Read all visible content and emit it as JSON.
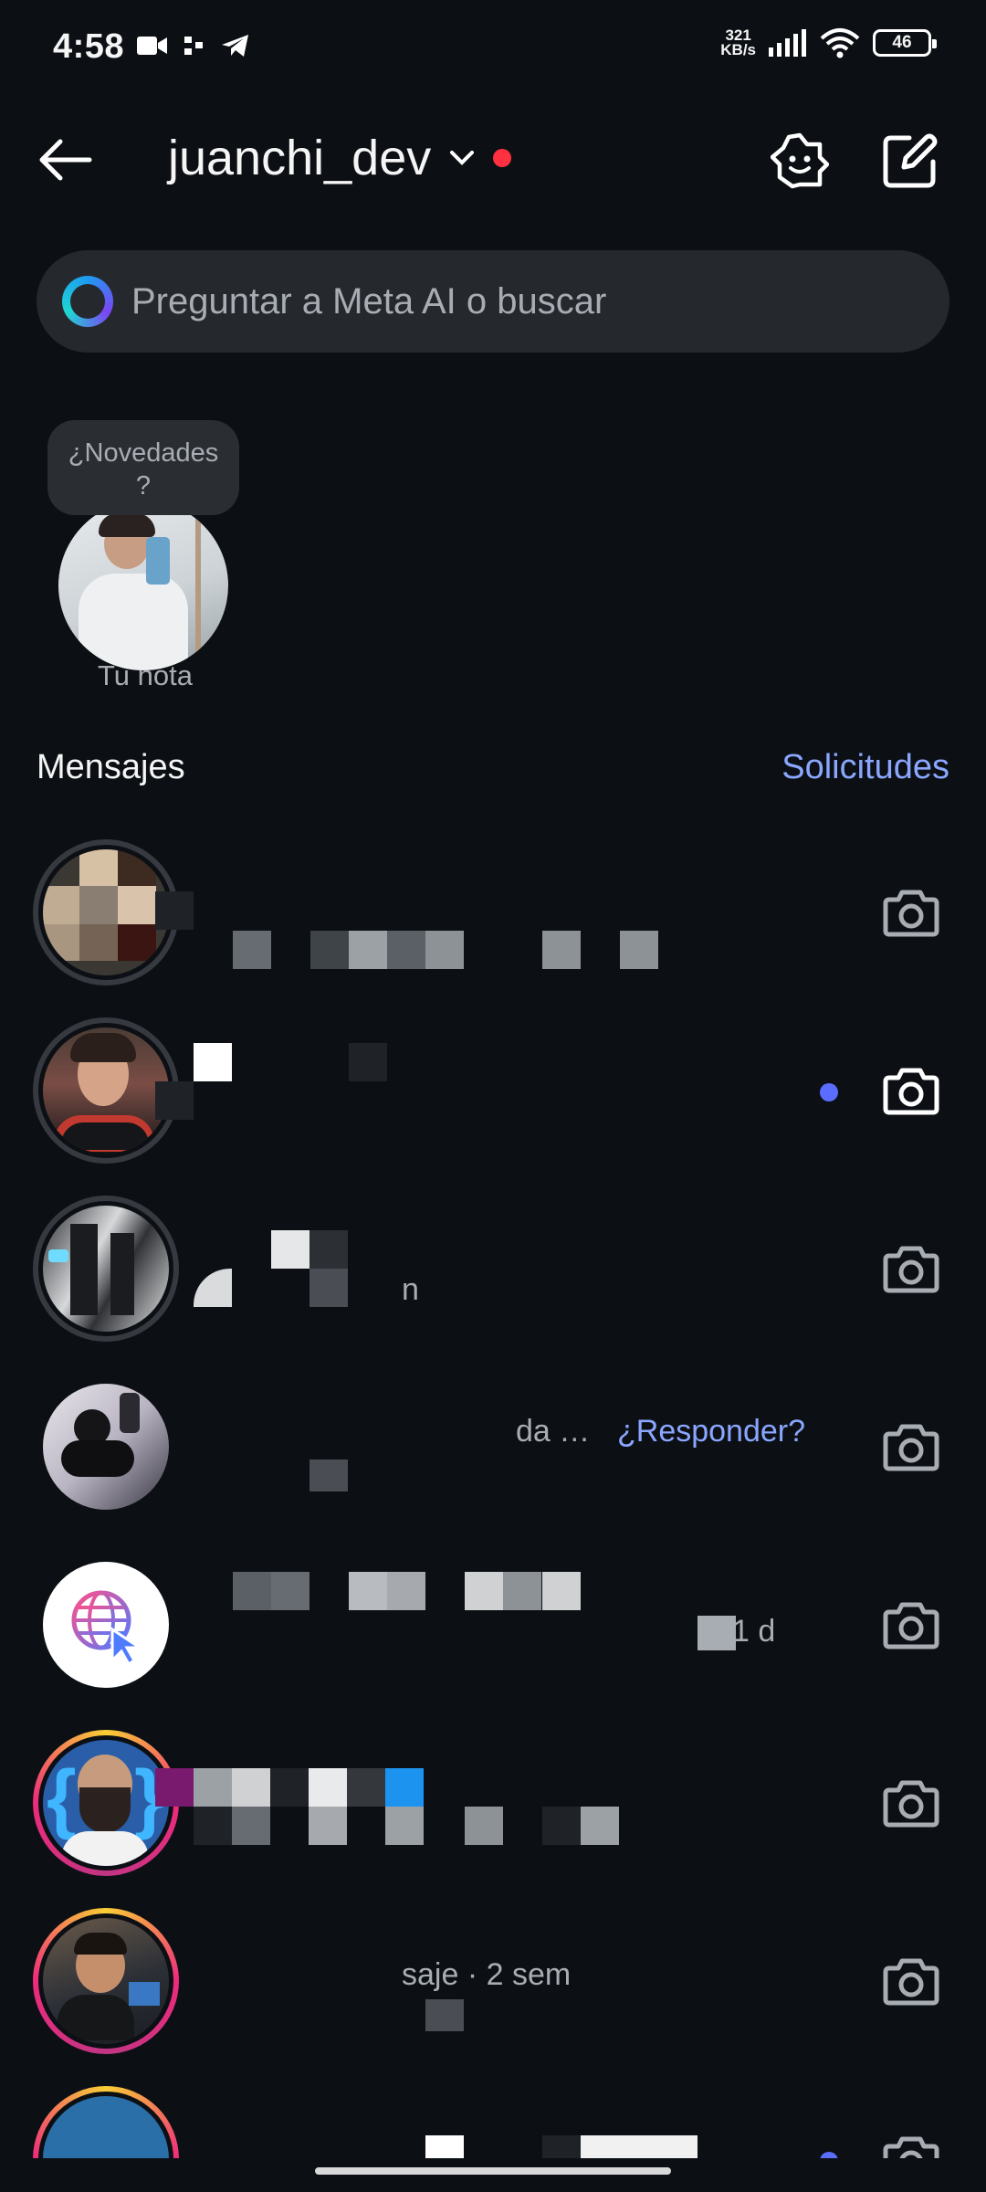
{
  "status_bar": {
    "time": "4:58",
    "net_speed_top": "321",
    "net_speed_bottom": "KB/s",
    "battery": "46"
  },
  "header": {
    "username": "juanchi_dev"
  },
  "search": {
    "placeholder": "Preguntar a Meta AI o buscar"
  },
  "note": {
    "bubble_line1": "¿Novedades",
    "bubble_line2": "?",
    "label": "Tu nota"
  },
  "messages": {
    "title": "Mensajes",
    "requests_link": "Solicitudes",
    "rows": [
      {
        "preview": "",
        "unread": false
      },
      {
        "preview": "",
        "unread": true
      },
      {
        "preview": "n",
        "unread": false
      },
      {
        "preview": "da …",
        "reply_prompt": "¿Responder?",
        "unread": false
      },
      {
        "preview": "1 d",
        "unread": false
      },
      {
        "preview": "",
        "unread": false
      },
      {
        "preview": "saje · 2 sem",
        "unread": false
      },
      {
        "preview": "",
        "unread": true
      }
    ]
  },
  "icons": [
    "back-arrow-icon",
    "chevron-down-icon",
    "ai-studio-icon",
    "compose-icon",
    "meta-ai-icon",
    "camera-icon"
  ],
  "colors": {
    "background": "#0c1014",
    "accent_link": "#8aa6ff",
    "unread_dot": "#5b6dff",
    "live_dot": "#ff3040"
  }
}
